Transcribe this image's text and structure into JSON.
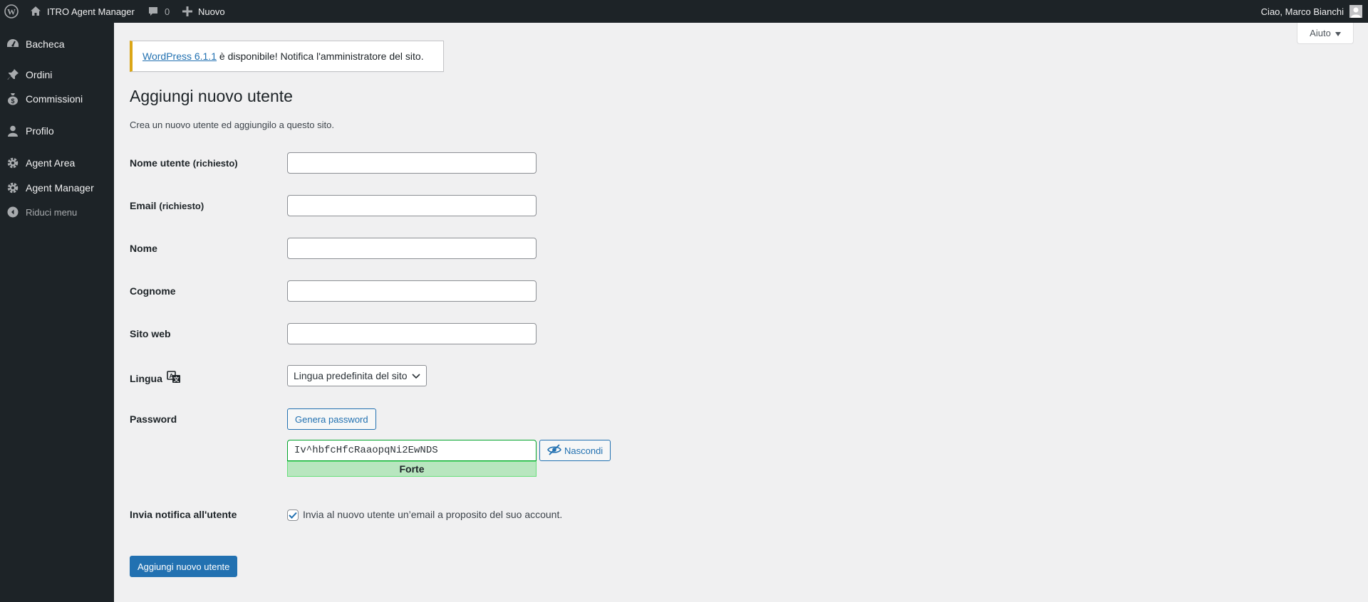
{
  "adminbar": {
    "site_name": "ITRO Agent Manager",
    "comments_count": "0",
    "new_label": "Nuovo",
    "greeting": "Ciao, Marco Bianchi"
  },
  "sidebar": {
    "items": [
      {
        "label": "Bacheca",
        "icon": "dashboard-icon"
      },
      {
        "label": "Ordini",
        "icon": "pin-icon"
      },
      {
        "label": "Commissioni",
        "icon": "money-bag-icon"
      },
      {
        "label": "Profilo",
        "icon": "user-icon"
      },
      {
        "label": "Agent Area",
        "icon": "gear-icon"
      },
      {
        "label": "Agent Manager",
        "icon": "gear-icon"
      }
    ],
    "collapse_label": "Riduci menu"
  },
  "help": {
    "label": "Aiuto"
  },
  "notice": {
    "link_text": "WordPress 6.1.1",
    "text": " è disponibile! Notifica l'amministratore del sito."
  },
  "page": {
    "title": "Aggiungi nuovo utente",
    "description": "Crea un nuovo utente ed aggiungilo a questo sito."
  },
  "form": {
    "username": {
      "label": "Nome utente",
      "required": "(richiesto)",
      "value": ""
    },
    "email": {
      "label": "Email",
      "required": "(richiesto)",
      "value": ""
    },
    "first_name": {
      "label": "Nome",
      "value": ""
    },
    "last_name": {
      "label": "Cognome",
      "value": ""
    },
    "website": {
      "label": "Sito web",
      "value": ""
    },
    "language": {
      "label": "Lingua",
      "selected": "Lingua predefinita del sito"
    },
    "password": {
      "label": "Password",
      "generate_label": "Genera password",
      "value": "Iv^hbfcHfcRaaopqNi2EwNDS",
      "hide_label": "Nascondi",
      "strength": "Forte"
    },
    "notify": {
      "label": "Invia notifica all'utente",
      "checkbox_label": "Invia al nuovo utente un’email a proposito del suo account.",
      "checked": true
    },
    "submit_label": "Aggiungi nuovo utente"
  },
  "colors": {
    "adminbar_bg": "#1d2327",
    "accent": "#2271b1",
    "notice_warning": "#dba617",
    "strength_strong": "#b8e6bf"
  }
}
